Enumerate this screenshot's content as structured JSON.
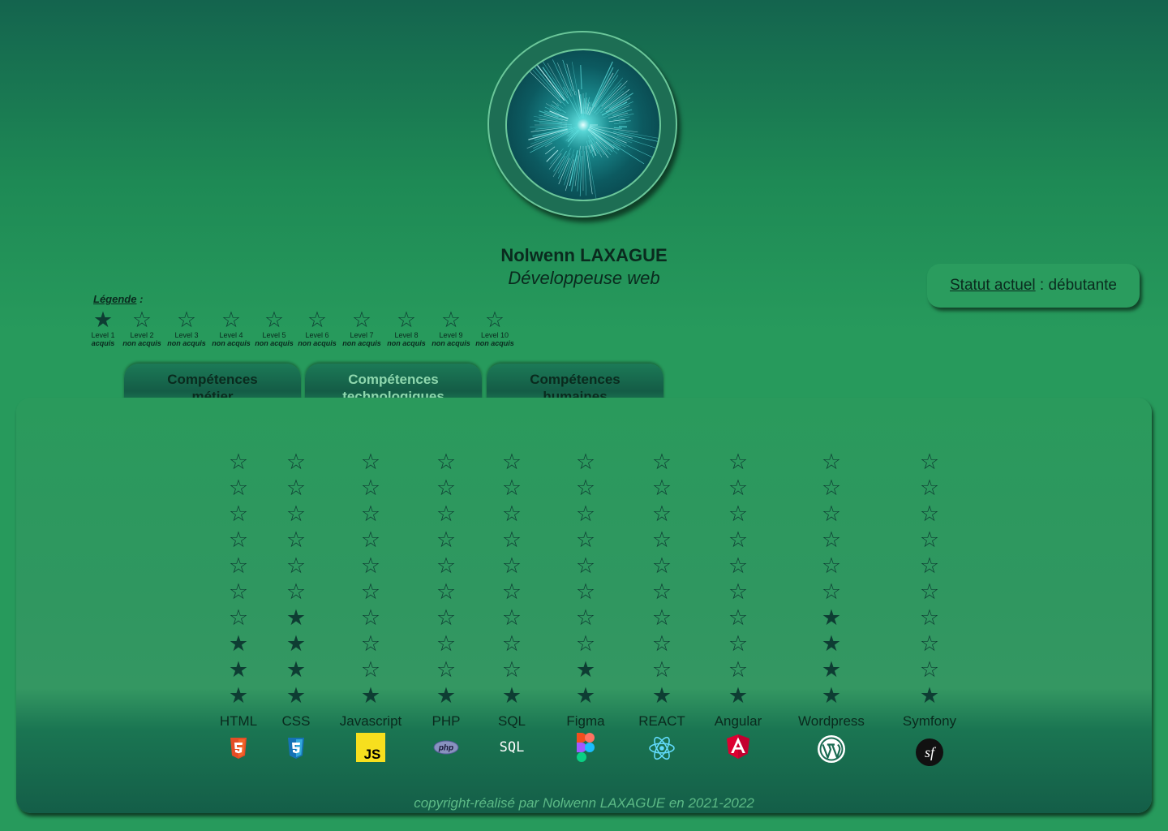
{
  "profile": {
    "name": "Nolwenn LAXAGUE",
    "role": "Développeuse web"
  },
  "status": {
    "label": "Statut actuel",
    "separator": " : ",
    "value": "débutante"
  },
  "legend": {
    "title": "Légende",
    "suffix": " :",
    "items": [
      {
        "level": "Level 1",
        "state": "acquis",
        "filled": true
      },
      {
        "level": "Level 2",
        "state": "non acquis",
        "filled": false
      },
      {
        "level": "Level 3",
        "state": "non acquis",
        "filled": false
      },
      {
        "level": "Level 4",
        "state": "non acquis",
        "filled": false
      },
      {
        "level": "Level 5",
        "state": "non acquis",
        "filled": false
      },
      {
        "level": "Level 6",
        "state": "non acquis",
        "filled": false
      },
      {
        "level": "Level 7",
        "state": "non acquis",
        "filled": false
      },
      {
        "level": "Level 8",
        "state": "non acquis",
        "filled": false
      },
      {
        "level": "Level 9",
        "state": "non acquis",
        "filled": false
      },
      {
        "level": "Level 10",
        "state": "non acquis",
        "filled": false
      }
    ]
  },
  "tabs": [
    {
      "line1": "Compétences",
      "line2": "métier",
      "active": false
    },
    {
      "line1": "Compétences",
      "line2": "technologiques",
      "active": true
    },
    {
      "line1": "Compétences",
      "line2": "humaines",
      "active": false
    }
  ],
  "skills": [
    {
      "name": "HTML",
      "level": 3,
      "max": 10,
      "icon": "html5-icon"
    },
    {
      "name": "CSS",
      "level": 4,
      "max": 10,
      "icon": "css3-icon"
    },
    {
      "name": "Javascript",
      "level": 1,
      "max": 10,
      "icon": "javascript-icon"
    },
    {
      "name": "PHP",
      "level": 1,
      "max": 10,
      "icon": "php-icon"
    },
    {
      "name": "SQL",
      "level": 1,
      "max": 10,
      "icon": "sql-icon"
    },
    {
      "name": "Figma",
      "level": 2,
      "max": 10,
      "icon": "figma-icon"
    },
    {
      "name": "REACT",
      "level": 1,
      "max": 10,
      "icon": "react-icon"
    },
    {
      "name": "Angular",
      "level": 1,
      "max": 10,
      "icon": "angular-icon"
    },
    {
      "name": "Wordpress",
      "level": 4,
      "max": 10,
      "icon": "wordpress-icon"
    },
    {
      "name": "Symfony",
      "level": 1,
      "max": 10,
      "icon": "symfony-icon"
    }
  ],
  "icon_glyphs": {
    "star_full": "★",
    "star_empty": "☆",
    "js_text": "JS",
    "php_text": "php",
    "sql_text": "SQL",
    "symfony_text": "sf"
  },
  "colors": {
    "html5": "#e44d26",
    "css3": "#1572b6",
    "javascript": "#f7df1e",
    "php": "#8892bf",
    "angular": "#dd0031",
    "react": "#61dafb"
  },
  "footer": "copyright-réalisé par Nolwenn LAXAGUE en 2021-2022"
}
